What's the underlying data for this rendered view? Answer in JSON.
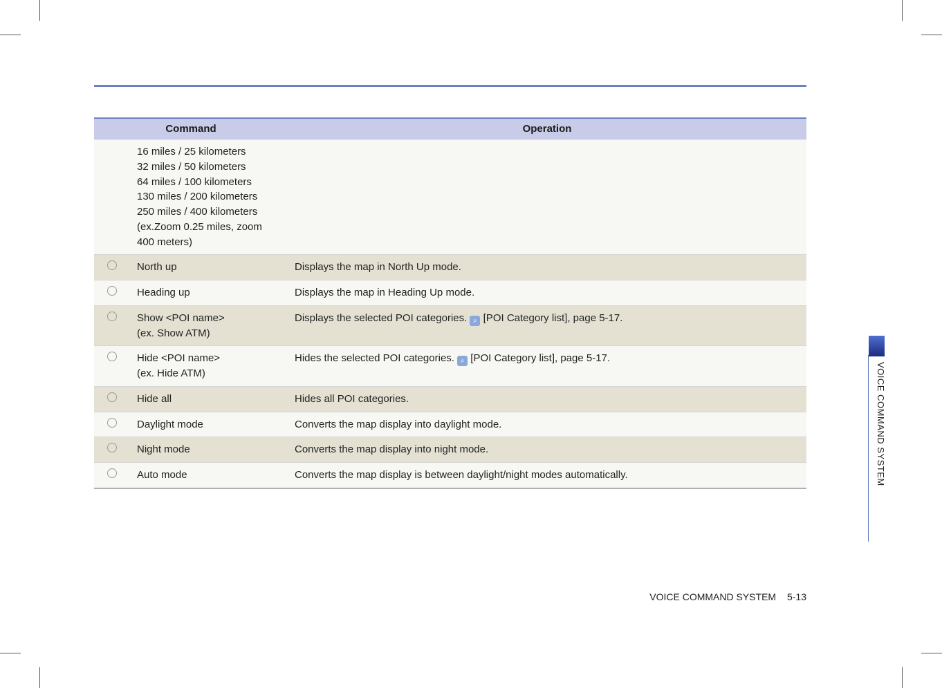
{
  "header": {
    "col_command": "Command",
    "col_operation": "Operation"
  },
  "rows": [
    {
      "mark": false,
      "command": "16 miles / 25 kilometers\n32 miles / 50 kilometers\n64 miles / 100 kilometers\n130 miles / 200 kilometers\n250 miles / 400 kilometers\n(ex.Zoom 0.25 miles, zoom 400 meters)",
      "operation": ""
    },
    {
      "mark": true,
      "command": "North up",
      "operation": "Displays the map in North Up mode."
    },
    {
      "mark": true,
      "command": "Heading up",
      "operation": "Displays the map in Heading Up mode."
    },
    {
      "mark": true,
      "command": "Show <POI name>\n(ex. Show ATM)",
      "operation_pre": "Displays the selected POI categories. ",
      "operation_ref": "[POI Category list], page 5-17.",
      "has_ref": true
    },
    {
      "mark": true,
      "command": "Hide <POI name>\n(ex. Hide ATM)",
      "operation_pre": "Hides the selected POI categories. ",
      "operation_ref": "[POI Category list], page 5-17.",
      "has_ref": true
    },
    {
      "mark": true,
      "command": "Hide all",
      "operation": "Hides all POI categories."
    },
    {
      "mark": true,
      "command": "Daylight mode",
      "operation": "Converts the map display into daylight mode."
    },
    {
      "mark": true,
      "command": "Night mode",
      "operation": "Converts the map display into night mode."
    },
    {
      "mark": true,
      "command": "Auto mode",
      "operation": "Converts the map display is between daylight/night modes automatically."
    }
  ],
  "sidebar": {
    "label": "VOICE COMMAND SYSTEM"
  },
  "footer": {
    "section": "VOICE COMMAND SYSTEM",
    "page": "5-13"
  },
  "ref_icon_glyph": "🔍"
}
